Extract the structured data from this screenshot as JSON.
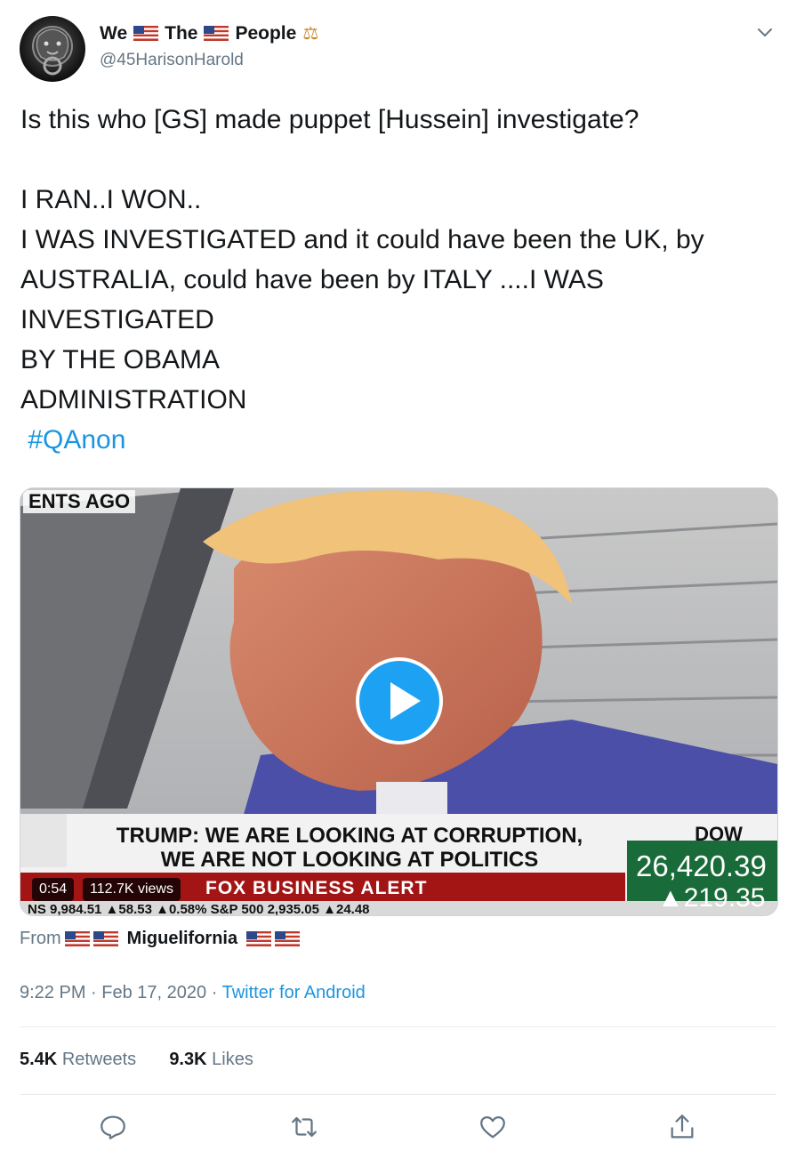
{
  "author": {
    "name_parts": [
      "We",
      "The",
      "People"
    ],
    "handle": "@45HarisonHarold",
    "avatar_icon": "lion-door-knocker-icon"
  },
  "tweet": {
    "text": "Is this who [GS] made puppet [Hussein] investigate?\n\nI RAN..I WON..\nI WAS INVESTIGATED and it could have been the UK, by AUSTRALIA, could have been by ITALY ....I WAS INVESTIGATED\nBY THE OBAMA\nADMINISTRATION\n ",
    "hashtag": "#QAnon"
  },
  "media": {
    "duration": "0:54",
    "views": "112.7K views",
    "corner_label": "ENTS AGO",
    "chyron_line1": "TRUMP: WE ARE LOOKING AT CORRUPTION,",
    "chyron_line2": "WE ARE NOT LOOKING AT POLITICS",
    "dow_label": "DOW",
    "dow_value": "26,420.39",
    "dow_change": "▲219.35",
    "banner": "FOX BUSINESS ALERT",
    "ticker": "NS 9,984.51 ▲58.53 ▲0.58%  S&P 500  2,935.05 ▲24.48"
  },
  "source_user": {
    "prefix": "From",
    "name": "Miguelifornia"
  },
  "meta": {
    "time": "9:22 PM",
    "separator": "·",
    "date": "Feb 17, 2020",
    "client": "Twitter for Android"
  },
  "stats": {
    "retweets_count": "5.4K",
    "retweets_label": "Retweets",
    "likes_count": "9.3K",
    "likes_label": "Likes"
  },
  "actions": [
    "reply-icon",
    "retweet-icon",
    "like-icon",
    "share-icon"
  ],
  "colors": {
    "link": "#1b95e0",
    "muted": "#657786",
    "accent": "#1da1f2"
  }
}
